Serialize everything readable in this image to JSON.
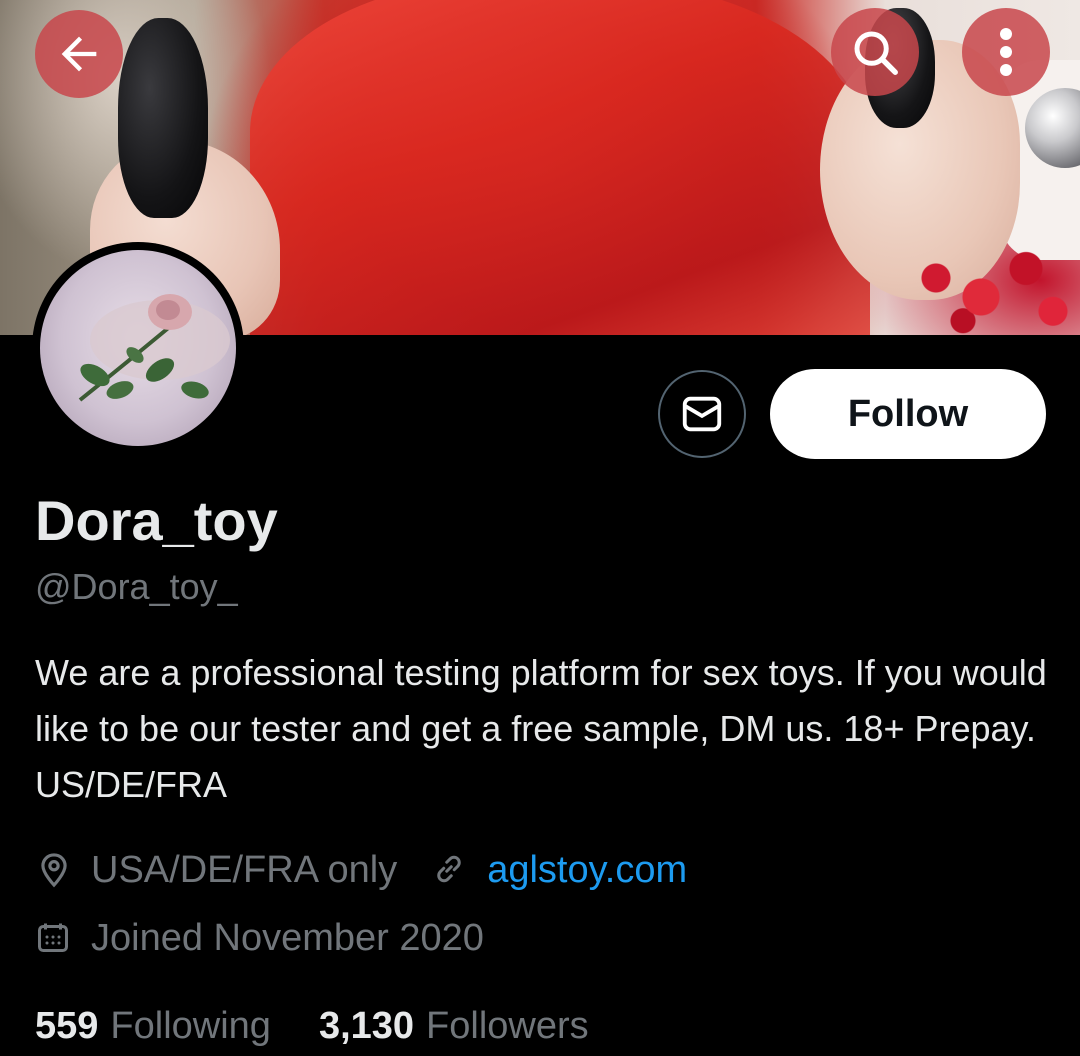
{
  "header": {
    "back_icon": "arrow-left-icon",
    "search_icon": "search-icon",
    "more_icon": "more-vertical-icon",
    "button_bg": "#c8464b"
  },
  "profile": {
    "display_name": "Dora_toy",
    "handle": "@Dora_toy_",
    "bio": "We are a professional testing platform for sex toys. If you would like to be our tester and get a free sample, DM us. 18+ Prepay. US/DE/FRA",
    "location": "USA/DE/FRA only",
    "website": "aglstoy.com",
    "joined": "Joined November 2020"
  },
  "actions": {
    "message_icon": "mail-icon",
    "follow_label": "Follow"
  },
  "stats": {
    "following_count": "559",
    "following_label": "Following",
    "followers_count": "3,130",
    "followers_label": "Followers"
  },
  "colors": {
    "background": "#000000",
    "text_primary": "#e7e9ea",
    "text_secondary": "#71767b",
    "link": "#1d9bf0",
    "follow_button_bg": "#ffffff"
  }
}
